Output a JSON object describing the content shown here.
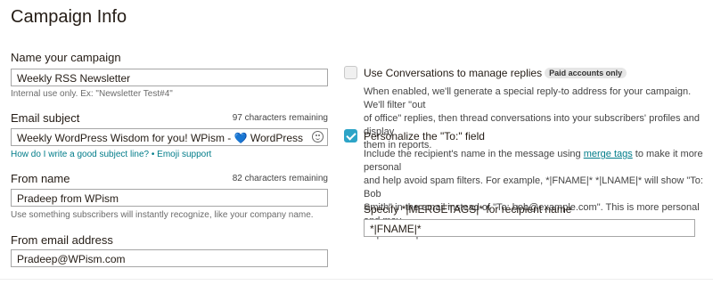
{
  "page_title": "Campaign Info",
  "campaign_name": {
    "label": "Name your campaign",
    "value": "Weekly RSS Newsletter",
    "hint": "Internal use only. Ex: \"Newsletter Test#4\""
  },
  "email_subject": {
    "label": "Email subject",
    "remaining": "97 characters remaining",
    "value_before": "Weekly WordPress Wisdom for you!  WPism - ",
    "heart": "💙",
    "value_after": " WordPress",
    "help_link": "How do I write a good subject line?",
    "separator": "•",
    "emoji_link": "Emoji support"
  },
  "from_name": {
    "label": "From name",
    "remaining": "82 characters remaining",
    "value": "Pradeep from WPism",
    "hint": "Use something subscribers will instantly recognize, like your company name."
  },
  "from_email": {
    "label": "From email address",
    "value": "Pradeep@WPism.com"
  },
  "conversations": {
    "checked": false,
    "title": "Use Conversations to manage replies",
    "badge": "Paid accounts only",
    "desc_line1": "When enabled, we'll generate a special reply-to address for your campaign. We'll filter \"out",
    "desc_line2": "of office\" replies, then thread conversations into your subscribers' profiles and display",
    "desc_line3": "them in reports."
  },
  "personalize": {
    "checked": true,
    "title": "Personalize the \"To:\" field",
    "desc_line1_a": "Include the recipient's name in the message using ",
    "desc_line1_link": "merge tags",
    "desc_line1_b": " to make it more personal",
    "desc_line2": "and help avoid spam filters. For example, *|FNAME|* *|LNAME|* will show \"To: Bob",
    "desc_line3": "Smith\" in the email instead of \"To: bob@example.com\". This is more personal and may",
    "desc_line4": "help avoid spam filters.",
    "merge_label": "Specify *|MERGETAGS|* for recipient name",
    "merge_value": "*|FNAME|*"
  },
  "colors": {
    "link": "#007c89",
    "checkbox_checked": "#2da4c7",
    "heart": "#3b88c3"
  }
}
